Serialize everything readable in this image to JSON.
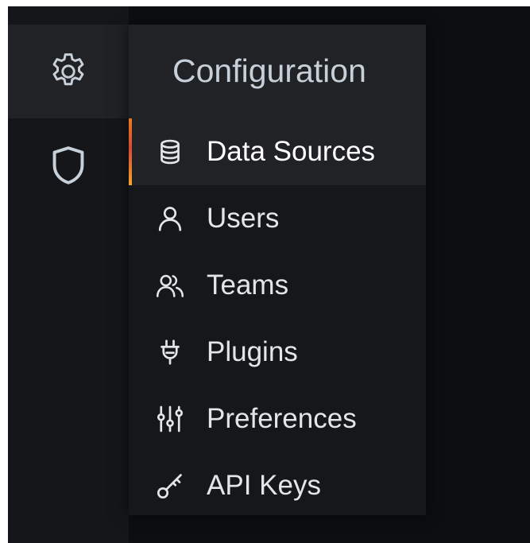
{
  "sidemenu": {
    "items": [
      {
        "name": "gear-icon"
      },
      {
        "name": "shield-icon"
      }
    ]
  },
  "configuration": {
    "title": "Configuration",
    "items": [
      {
        "label": "Data Sources",
        "icon": "database-icon",
        "active": true
      },
      {
        "label": "Users",
        "icon": "user-icon",
        "active": false
      },
      {
        "label": "Teams",
        "icon": "users-icon",
        "active": false
      },
      {
        "label": "Plugins",
        "icon": "plug-icon",
        "active": false
      },
      {
        "label": "Preferences",
        "icon": "sliders-icon",
        "active": false
      },
      {
        "label": "API Keys",
        "icon": "key-icon",
        "active": false
      }
    ]
  },
  "colors": {
    "background": "#0d0e12",
    "sidemenu": "#141619",
    "hover": "#202226",
    "dropdown": "#16171b",
    "text": "#e3e5e8",
    "title": "#c7d0d9",
    "accent": "#eb7b18"
  }
}
